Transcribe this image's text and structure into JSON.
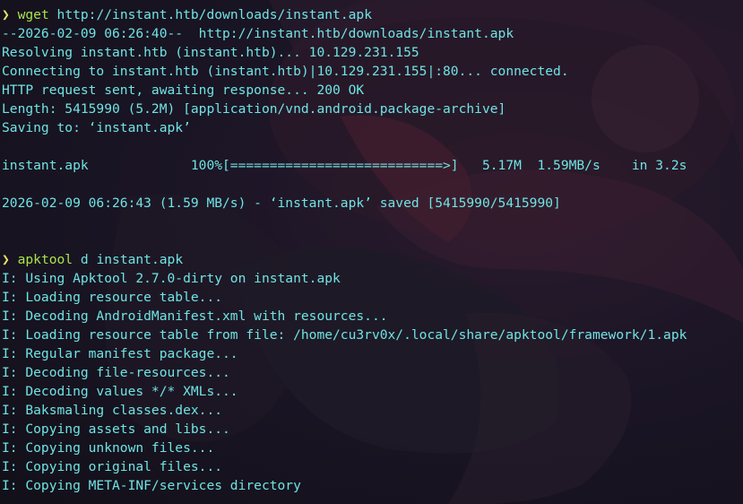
{
  "colors": {
    "text": "#6fe3e3",
    "command": "#a9e34b",
    "prompt": "#e6e36a",
    "background": "#14121f"
  },
  "terminal": {
    "prompt_glyph": "❯",
    "block1": {
      "command": "wget",
      "args": " http://instant.htb/downloads/instant.apk",
      "output": [
        "--2026-02-09 06:26:40--  http://instant.htb/downloads/instant.apk",
        "Resolving instant.htb (instant.htb)... 10.129.231.155",
        "Connecting to instant.htb (instant.htb)|10.129.231.155|:80... connected.",
        "HTTP request sent, awaiting response... 200 OK",
        "Length: 5415990 (5.2M) [application/vnd.android.package-archive]",
        "Saving to: ‘instant.apk’",
        "",
        "instant.apk             100%[===========================>]   5.17M  1.59MB/s    in 3.2s",
        "",
        "2026-02-09 06:26:43 (1.59 MB/s) - ‘instant.apk’ saved [5415990/5415990]",
        "",
        ""
      ]
    },
    "block2": {
      "command": "apktool",
      "args": " d instant.apk",
      "output": [
        "I: Using Apktool 2.7.0-dirty on instant.apk",
        "I: Loading resource table...",
        "I: Decoding AndroidManifest.xml with resources...",
        "I: Loading resource table from file: /home/cu3rv0x/.local/share/apktool/framework/1.apk",
        "I: Regular manifest package...",
        "I: Decoding file-resources...",
        "I: Decoding values */* XMLs...",
        "I: Baksmaling classes.dex...",
        "I: Copying assets and libs...",
        "I: Copying unknown files...",
        "I: Copying original files...",
        "I: Copying META-INF/services directory"
      ]
    }
  }
}
